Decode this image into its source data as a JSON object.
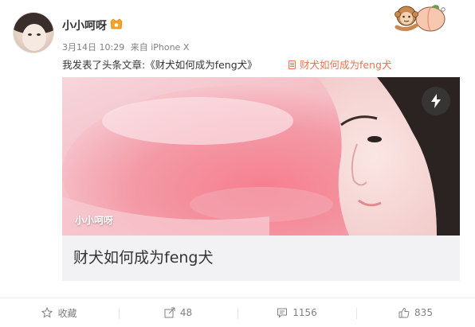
{
  "user": {
    "name": "小小呵呀"
  },
  "meta": {
    "date": "3月14日 10:29",
    "source": "来自 iPhone X"
  },
  "post": {
    "text": "我发表了头条文章:《财犬如何成为feng犬》",
    "link_label": "财犬如何成为feng犬"
  },
  "article": {
    "cover_author": "小小呵呀",
    "title": "财犬如何成为feng犬"
  },
  "actions": [
    {
      "label": "收藏",
      "icon": "star-icon"
    },
    {
      "label": "48",
      "icon": "share-icon"
    },
    {
      "label": "1156",
      "icon": "comment-icon"
    },
    {
      "label": "835",
      "icon": "like-icon"
    }
  ],
  "colors": {
    "link": "#eb7350",
    "muted": "#808080",
    "text": "#333333"
  }
}
